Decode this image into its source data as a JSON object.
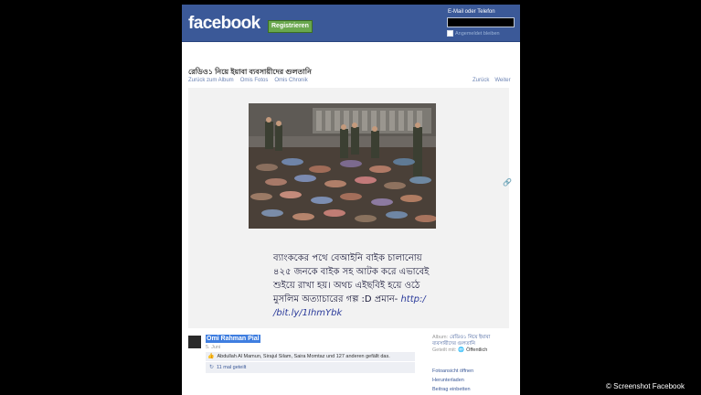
{
  "header": {
    "logo": "facebook",
    "register_label": "Registrieren",
    "login_label": "E-Mail oder Telefon",
    "remember_label": "Angemeldet bleiben"
  },
  "album": {
    "title": "রেডিও১ নিয়ে ইয়াবা ব্যবসায়ীদের গুলতানি",
    "links": [
      "Zurück zum Album",
      "Omis Fotos",
      "Omis Chronik"
    ],
    "nav": [
      "Zurück",
      "Weiter"
    ]
  },
  "photo": {
    "caption_lines": [
      "ব্যাংককের পথে বেআইনি বাইক চালানোয়",
      "৪২৫ জনকে বাইক সহ আটক করে এভাবেই",
      "শুইয়ে রাখা হয়। অথচ এইছবিই হয়ে ওঠে",
      "মুসলিম অত্যাচারের গল্প :D প্রমান-"
    ],
    "caption_link_start": "http:/",
    "caption_link_end": "/bit.ly/1IhmYbk"
  },
  "post": {
    "author": "Omi Rahman Pial",
    "date": "5. Juni",
    "likes_text": "Abdullah Al Mamun, Sirajul Silam, Saira Momtaz und 127 anderen gefällt das.",
    "shares_text": "11 mal geteilt"
  },
  "sidebar": {
    "album_label": "Album:",
    "album_value_1": "রেডিও১ নিয়ে ইয়াবা",
    "album_value_2": "ব্যবসায়ীদের গুলতানি",
    "shared_label": "Geteilt mit:",
    "shared_value": "Öffentlich",
    "actions": [
      "Fotoansicht öffnen",
      "Herunterladen",
      "Beitrag einbetten"
    ]
  },
  "credit": "© Screenshot Facebook",
  "colors": {
    "header_blue": "#3b5998",
    "register_green": "#69a74e",
    "link_blue": "#6d84b4"
  }
}
